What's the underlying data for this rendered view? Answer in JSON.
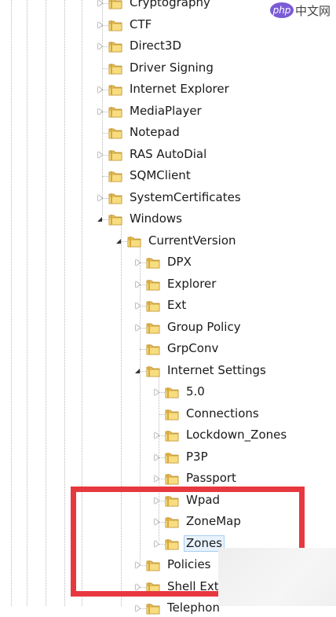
{
  "watermark": {
    "badge": "php",
    "text": "中文网"
  },
  "tree": [
    {
      "label": "Cryptography",
      "level": 0,
      "expander": "collapsed"
    },
    {
      "label": "CTF",
      "level": 0,
      "expander": "collapsed"
    },
    {
      "label": "Direct3D",
      "level": 0,
      "expander": "collapsed"
    },
    {
      "label": "Driver Signing",
      "level": 0,
      "expander": "none"
    },
    {
      "label": "Internet Explorer",
      "level": 0,
      "expander": "collapsed"
    },
    {
      "label": "MediaPlayer",
      "level": 0,
      "expander": "collapsed"
    },
    {
      "label": "Notepad",
      "level": 0,
      "expander": "none"
    },
    {
      "label": "RAS AutoDial",
      "level": 0,
      "expander": "collapsed"
    },
    {
      "label": "SQMClient",
      "level": 0,
      "expander": "none"
    },
    {
      "label": "SystemCertificates",
      "level": 0,
      "expander": "collapsed"
    },
    {
      "label": "Windows",
      "level": 0,
      "expander": "expanded"
    },
    {
      "label": "CurrentVersion",
      "level": 1,
      "expander": "expanded"
    },
    {
      "label": "DPX",
      "level": 2,
      "expander": "collapsed"
    },
    {
      "label": "Explorer",
      "level": 2,
      "expander": "collapsed"
    },
    {
      "label": "Ext",
      "level": 2,
      "expander": "collapsed"
    },
    {
      "label": "Group Policy",
      "level": 2,
      "expander": "collapsed"
    },
    {
      "label": "GrpConv",
      "level": 2,
      "expander": "none"
    },
    {
      "label": "Internet Settings",
      "level": 2,
      "expander": "expanded"
    },
    {
      "label": "5.0",
      "level": 3,
      "expander": "collapsed"
    },
    {
      "label": "Connections",
      "level": 3,
      "expander": "none"
    },
    {
      "label": "Lockdown_Zones",
      "level": 3,
      "expander": "collapsed"
    },
    {
      "label": "P3P",
      "level": 3,
      "expander": "collapsed"
    },
    {
      "label": "Passport",
      "level": 3,
      "expander": "collapsed"
    },
    {
      "label": "Wpad",
      "level": 3,
      "expander": "collapsed"
    },
    {
      "label": "ZoneMap",
      "level": 3,
      "expander": "collapsed"
    },
    {
      "label": "Zones",
      "level": 3,
      "expander": "collapsed",
      "selected": true
    },
    {
      "label": "Policies",
      "level": 2,
      "expander": "collapsed"
    },
    {
      "label": "Shell Ext",
      "level": 2,
      "expander": "collapsed"
    },
    {
      "label": "Telephon",
      "level": 2,
      "expander": "collapsed"
    }
  ]
}
